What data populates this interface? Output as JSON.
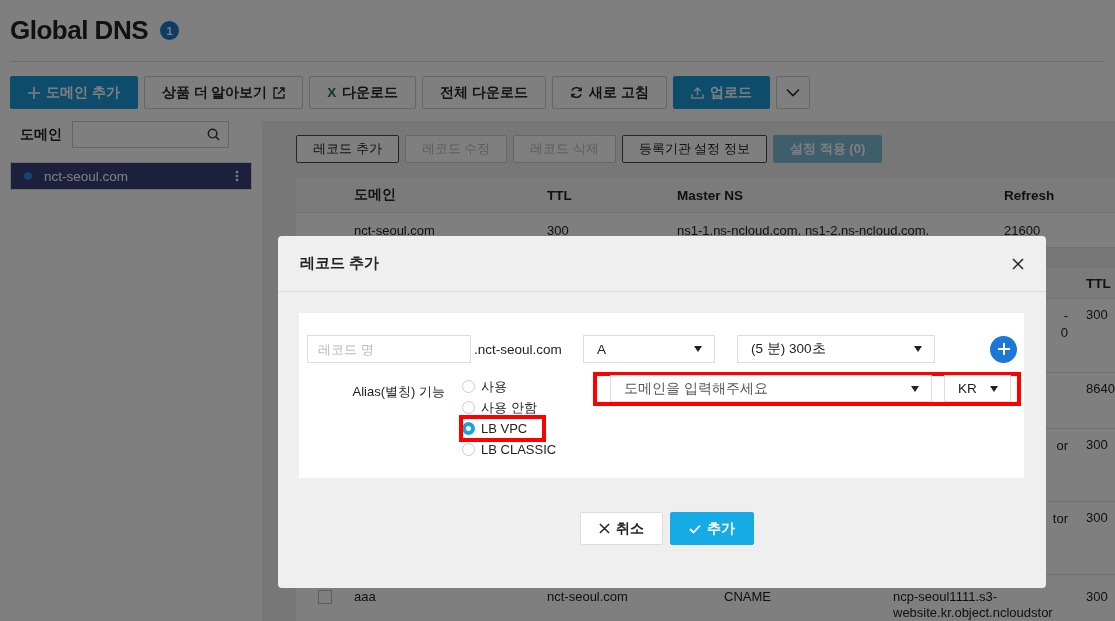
{
  "header": {
    "title": "Global DNS",
    "badge": "1"
  },
  "toolbar": [
    {
      "kind": "add",
      "label": "도메인 추가"
    },
    {
      "kind": "link",
      "label": "상품 더 알아보기"
    },
    {
      "kind": "download",
      "glyph": "X",
      "label": "다운로드"
    },
    {
      "kind": "plain",
      "label": "전체 다운로드"
    },
    {
      "kind": "refresh",
      "label": "새로 고침"
    },
    {
      "kind": "upload",
      "label": "업로드"
    },
    {
      "kind": "menu"
    }
  ],
  "sidebar": {
    "label": "도메인",
    "items": [
      {
        "name": "nct-seoul.com",
        "selected": true
      }
    ]
  },
  "record_actions": [
    {
      "label": "레코드 추가",
      "disabled": false,
      "kind": "outline"
    },
    {
      "label": "레코드 수정",
      "disabled": true,
      "kind": "outline"
    },
    {
      "label": "레코드 삭제",
      "disabled": true,
      "kind": "outline"
    },
    {
      "label": "등록기관 설정 정보",
      "disabled": false,
      "kind": "outline"
    },
    {
      "label": "설정 적용 (0)",
      "disabled": true,
      "kind": "apply"
    }
  ],
  "domain_table": {
    "columns": [
      "도메인",
      "TTL",
      "Master NS",
      "Refresh"
    ],
    "rows": [
      [
        "nct-seoul.com",
        "300",
        "ns1-1.ns-ncloud.com. ns1-2.ns-ncloud.com.",
        "21600"
      ]
    ]
  },
  "records_table": {
    "columns": [
      "TTL"
    ],
    "rows": [
      {
        "value_lines": [
          "-",
          "0"
        ],
        "ttl": "300"
      },
      {
        "ttl": "8640"
      },
      {
        "value_lines": [
          "or"
        ],
        "ttl": "300"
      },
      {
        "value_lines": [
          "tor"
        ],
        "ttl": "300"
      },
      {
        "checked": false,
        "name": "aaa",
        "domain": "nct-seoul.com",
        "type": "CNAME",
        "value_lines": [
          "ncp-seoul1111.s3-",
          "website.kr.object.ncloudstor"
        ],
        "ttl": "300"
      }
    ]
  },
  "dialog": {
    "title": "레코드 추가",
    "record_name": {
      "placeholder": "레코드 명"
    },
    "domain_suffix": ".nct-seoul.com",
    "record_type": {
      "value": "A"
    },
    "ttl": {
      "value": "(5 분) 300초"
    },
    "alias_label": "Alias(별칭) 기능",
    "alias_options": [
      {
        "label": "사용",
        "selected": false,
        "highlighted": false
      },
      {
        "label": "사용 안함",
        "selected": false,
        "highlighted": false
      },
      {
        "label": "LB VPC",
        "selected": true,
        "highlighted": true
      },
      {
        "label": "LB CLASSIC",
        "selected": false,
        "highlighted": false
      }
    ],
    "alias_target": {
      "placeholder": "도메인을 입력해주세요",
      "region": "KR",
      "highlighted": true
    },
    "buttons": [
      {
        "kind": "cancel",
        "label": "취소"
      },
      {
        "kind": "confirm",
        "label": "추가"
      }
    ]
  }
}
